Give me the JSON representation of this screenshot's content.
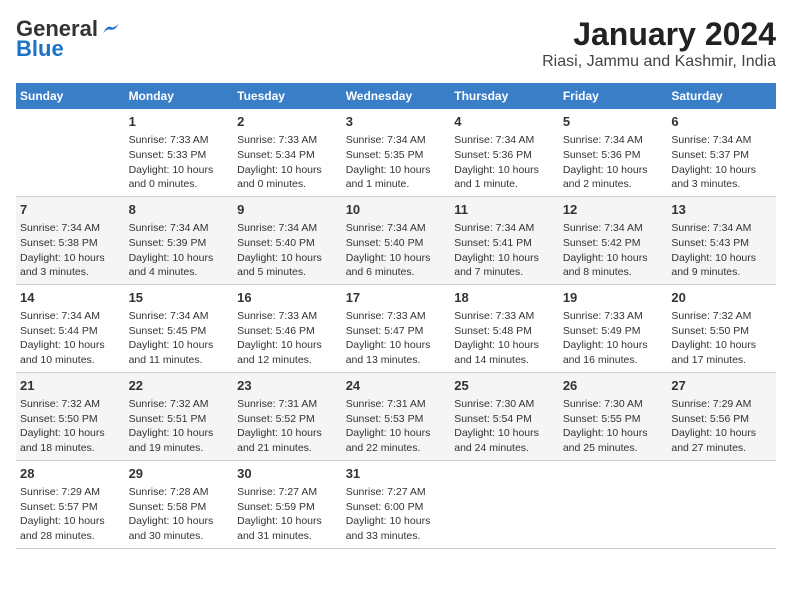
{
  "logo": {
    "general": "General",
    "blue": "Blue"
  },
  "title": "January 2024",
  "subtitle": "Riasi, Jammu and Kashmir, India",
  "days_of_week": [
    "Sunday",
    "Monday",
    "Tuesday",
    "Wednesday",
    "Thursday",
    "Friday",
    "Saturday"
  ],
  "weeks": [
    [
      {
        "day": "",
        "content": ""
      },
      {
        "day": "1",
        "content": "Sunrise: 7:33 AM\nSunset: 5:33 PM\nDaylight: 10 hours\nand 0 minutes."
      },
      {
        "day": "2",
        "content": "Sunrise: 7:33 AM\nSunset: 5:34 PM\nDaylight: 10 hours\nand 0 minutes."
      },
      {
        "day": "3",
        "content": "Sunrise: 7:34 AM\nSunset: 5:35 PM\nDaylight: 10 hours\nand 1 minute."
      },
      {
        "day": "4",
        "content": "Sunrise: 7:34 AM\nSunset: 5:36 PM\nDaylight: 10 hours\nand 1 minute."
      },
      {
        "day": "5",
        "content": "Sunrise: 7:34 AM\nSunset: 5:36 PM\nDaylight: 10 hours\nand 2 minutes."
      },
      {
        "day": "6",
        "content": "Sunrise: 7:34 AM\nSunset: 5:37 PM\nDaylight: 10 hours\nand 3 minutes."
      }
    ],
    [
      {
        "day": "7",
        "content": "Sunrise: 7:34 AM\nSunset: 5:38 PM\nDaylight: 10 hours\nand 3 minutes."
      },
      {
        "day": "8",
        "content": "Sunrise: 7:34 AM\nSunset: 5:39 PM\nDaylight: 10 hours\nand 4 minutes."
      },
      {
        "day": "9",
        "content": "Sunrise: 7:34 AM\nSunset: 5:40 PM\nDaylight: 10 hours\nand 5 minutes."
      },
      {
        "day": "10",
        "content": "Sunrise: 7:34 AM\nSunset: 5:40 PM\nDaylight: 10 hours\nand 6 minutes."
      },
      {
        "day": "11",
        "content": "Sunrise: 7:34 AM\nSunset: 5:41 PM\nDaylight: 10 hours\nand 7 minutes."
      },
      {
        "day": "12",
        "content": "Sunrise: 7:34 AM\nSunset: 5:42 PM\nDaylight: 10 hours\nand 8 minutes."
      },
      {
        "day": "13",
        "content": "Sunrise: 7:34 AM\nSunset: 5:43 PM\nDaylight: 10 hours\nand 9 minutes."
      }
    ],
    [
      {
        "day": "14",
        "content": "Sunrise: 7:34 AM\nSunset: 5:44 PM\nDaylight: 10 hours\nand 10 minutes."
      },
      {
        "day": "15",
        "content": "Sunrise: 7:34 AM\nSunset: 5:45 PM\nDaylight: 10 hours\nand 11 minutes."
      },
      {
        "day": "16",
        "content": "Sunrise: 7:33 AM\nSunset: 5:46 PM\nDaylight: 10 hours\nand 12 minutes."
      },
      {
        "day": "17",
        "content": "Sunrise: 7:33 AM\nSunset: 5:47 PM\nDaylight: 10 hours\nand 13 minutes."
      },
      {
        "day": "18",
        "content": "Sunrise: 7:33 AM\nSunset: 5:48 PM\nDaylight: 10 hours\nand 14 minutes."
      },
      {
        "day": "19",
        "content": "Sunrise: 7:33 AM\nSunset: 5:49 PM\nDaylight: 10 hours\nand 16 minutes."
      },
      {
        "day": "20",
        "content": "Sunrise: 7:32 AM\nSunset: 5:50 PM\nDaylight: 10 hours\nand 17 minutes."
      }
    ],
    [
      {
        "day": "21",
        "content": "Sunrise: 7:32 AM\nSunset: 5:50 PM\nDaylight: 10 hours\nand 18 minutes."
      },
      {
        "day": "22",
        "content": "Sunrise: 7:32 AM\nSunset: 5:51 PM\nDaylight: 10 hours\nand 19 minutes."
      },
      {
        "day": "23",
        "content": "Sunrise: 7:31 AM\nSunset: 5:52 PM\nDaylight: 10 hours\nand 21 minutes."
      },
      {
        "day": "24",
        "content": "Sunrise: 7:31 AM\nSunset: 5:53 PM\nDaylight: 10 hours\nand 22 minutes."
      },
      {
        "day": "25",
        "content": "Sunrise: 7:30 AM\nSunset: 5:54 PM\nDaylight: 10 hours\nand 24 minutes."
      },
      {
        "day": "26",
        "content": "Sunrise: 7:30 AM\nSunset: 5:55 PM\nDaylight: 10 hours\nand 25 minutes."
      },
      {
        "day": "27",
        "content": "Sunrise: 7:29 AM\nSunset: 5:56 PM\nDaylight: 10 hours\nand 27 minutes."
      }
    ],
    [
      {
        "day": "28",
        "content": "Sunrise: 7:29 AM\nSunset: 5:57 PM\nDaylight: 10 hours\nand 28 minutes."
      },
      {
        "day": "29",
        "content": "Sunrise: 7:28 AM\nSunset: 5:58 PM\nDaylight: 10 hours\nand 30 minutes."
      },
      {
        "day": "30",
        "content": "Sunrise: 7:27 AM\nSunset: 5:59 PM\nDaylight: 10 hours\nand 31 minutes."
      },
      {
        "day": "31",
        "content": "Sunrise: 7:27 AM\nSunset: 6:00 PM\nDaylight: 10 hours\nand 33 minutes."
      },
      {
        "day": "",
        "content": ""
      },
      {
        "day": "",
        "content": ""
      },
      {
        "day": "",
        "content": ""
      }
    ]
  ]
}
